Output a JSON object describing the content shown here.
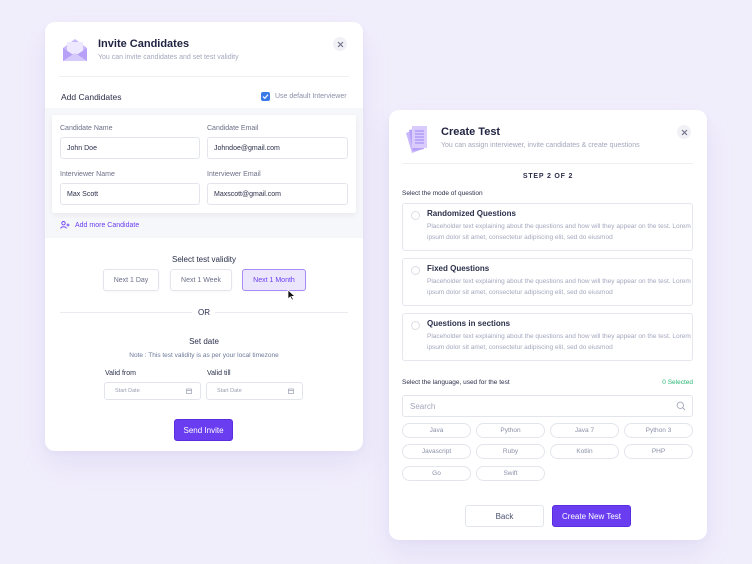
{
  "invite": {
    "title": "Invite Candidates",
    "subtitle": "You can invite candidates and set test validity",
    "header_icon": "envelope-open-icon",
    "close_icon": "close-icon",
    "add_candidates_label": "Add Candidates",
    "use_default_interviewer": {
      "label": "Use default Interviewer",
      "checked": true
    },
    "fields": {
      "candidate_name": {
        "label": "Candidate Name",
        "value": "John Doe"
      },
      "candidate_email": {
        "label": "Candidate Email",
        "value": "Johndoe@gmail.com"
      },
      "interviewer_name": {
        "label": "Interviewer Name",
        "value": "Max Scott"
      },
      "interviewer_email": {
        "label": "Interviewer Email",
        "value": "Maxscott@gmail.com"
      }
    },
    "add_more_label": "Add more Candidate",
    "add_more_icon": "user-plus-icon",
    "validity": {
      "label": "Select test validity",
      "options": [
        "Next 1 Day",
        "Next 1 Week",
        "Next 1 Month"
      ],
      "selected": "Next 1 Month"
    },
    "or_label": "OR",
    "set_date": {
      "label": "Set date",
      "note": "Note : This test validity is as per your local timezone",
      "valid_from": {
        "label": "Valid from",
        "placeholder": "Start Date"
      },
      "valid_till": {
        "label": "Valid till",
        "placeholder": "Start Date"
      }
    },
    "send_button": "Send Invite"
  },
  "create": {
    "title": "Create Test",
    "subtitle": "You can assign interviewer, invite candidates & create questions",
    "header_icon": "documents-icon",
    "close_icon": "close-icon",
    "step": "STEP 2 OF 2",
    "mode_label": "Select the mode of question",
    "modes": [
      {
        "title": "Randomized Questions",
        "desc": "Placeholder text explaining about the questions and how will they appear on the test. Lorem ipsum dolor sit amet, consectetur adipiscing elit, sed do eiusmod"
      },
      {
        "title": "Fixed Questions",
        "desc": "Placeholder text explaining about the questions and how will they appear on the test. Lorem ipsum dolor sit amet, consectetur adipiscing elit, sed do eiusmod"
      },
      {
        "title": "Questions in sections",
        "desc": "Placeholder text explaining about the questions and how will they appear on the test. Lorem ipsum dolor sit amet, consectetur adipiscing elit, sed do eiusmod"
      }
    ],
    "language_label": "Select the language, used for the test",
    "selected_count": "0 Selected",
    "search_placeholder": "Search",
    "languages": [
      "Java",
      "Python",
      "Java 7",
      "Python 3",
      "Javascript",
      "Ruby",
      "Kotlin",
      "PHP",
      "Go",
      "Swift"
    ],
    "back_button": "Back",
    "create_button": "Create New Test"
  },
  "colors": {
    "accent": "#6a3ef0",
    "background": "#f1eefc",
    "success": "#2bb673",
    "checkbox": "#3b7be8"
  }
}
